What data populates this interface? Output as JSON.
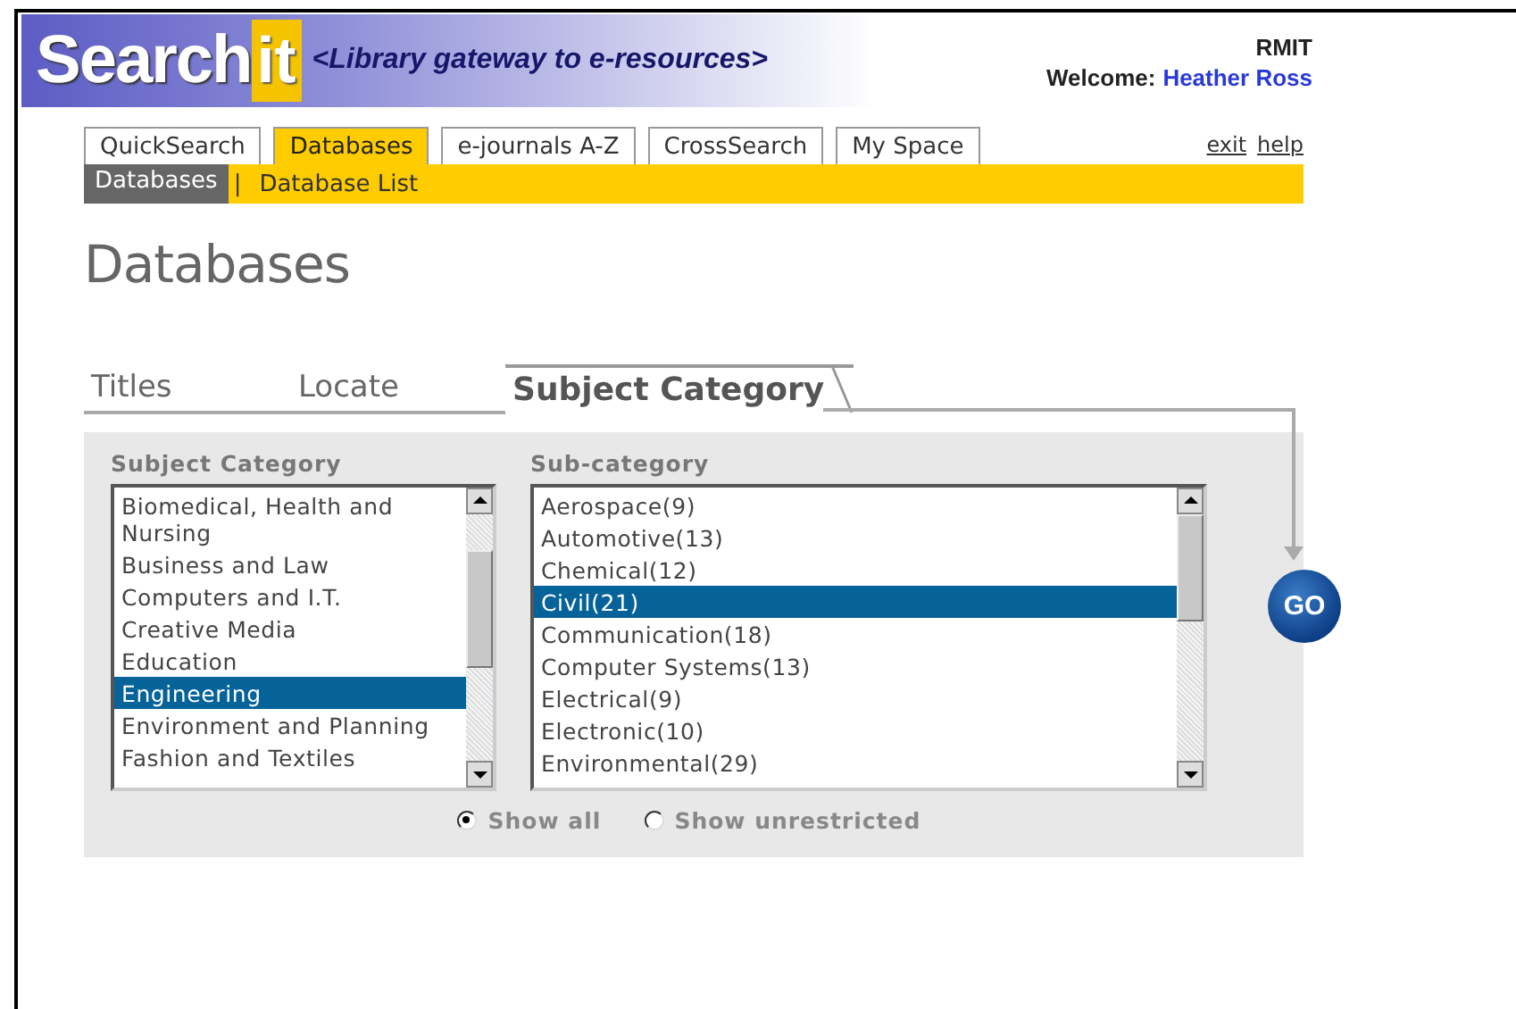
{
  "header": {
    "logo": {
      "word": "Search",
      "badge": "it"
    },
    "tagline": "<Library gateway to e-resources>",
    "institution": "RMIT",
    "welcome_label": "Welcome:",
    "user_name": "Heather Ross"
  },
  "nav_tabs": [
    {
      "label": "QuickSearch",
      "selected": false
    },
    {
      "label": "Databases",
      "selected": true
    },
    {
      "label": "e-journals A-Z",
      "selected": false
    },
    {
      "label": "CrossSearch",
      "selected": false
    },
    {
      "label": "My Space",
      "selected": false
    }
  ],
  "links": [
    "exit",
    "help"
  ],
  "sub_nav": [
    {
      "label": "Databases",
      "selected": true
    },
    {
      "label": "Database List",
      "selected": false
    }
  ],
  "sub_nav_separator": "|",
  "page_title": "Databases",
  "search_tabs": [
    {
      "label": "Titles",
      "selected": false
    },
    {
      "label": "Locate",
      "selected": false
    },
    {
      "label": "Subject Category",
      "selected": true
    }
  ],
  "panel": {
    "lists": [
      {
        "heading": "Subject Category",
        "items": [
          {
            "label": "Biomedical, Health and Nursing",
            "selected": false
          },
          {
            "label": "Business and Law",
            "selected": false
          },
          {
            "label": "Computers and I.T.",
            "selected": false
          },
          {
            "label": "Creative Media",
            "selected": false
          },
          {
            "label": "Education",
            "selected": false
          },
          {
            "label": "Engineering",
            "selected": true
          },
          {
            "label": "Environment and Planning",
            "selected": false
          },
          {
            "label": "Fashion and Textiles",
            "selected": false
          }
        ]
      },
      {
        "heading": "Sub-category",
        "items": [
          {
            "label": "Aerospace(9)",
            "selected": false
          },
          {
            "label": "Automotive(13)",
            "selected": false
          },
          {
            "label": "Chemical(12)",
            "selected": false
          },
          {
            "label": "Civil(21)",
            "selected": true
          },
          {
            "label": "Communication(18)",
            "selected": false
          },
          {
            "label": "Computer Systems(13)",
            "selected": false
          },
          {
            "label": "Electrical(9)",
            "selected": false
          },
          {
            "label": "Electronic(10)",
            "selected": false
          },
          {
            "label": "Environmental(29)",
            "selected": false
          }
        ]
      }
    ],
    "filters": [
      {
        "label": "Show all",
        "selected": true
      },
      {
        "label": "Show unrestricted",
        "selected": false
      }
    ],
    "go_button": "GO"
  }
}
